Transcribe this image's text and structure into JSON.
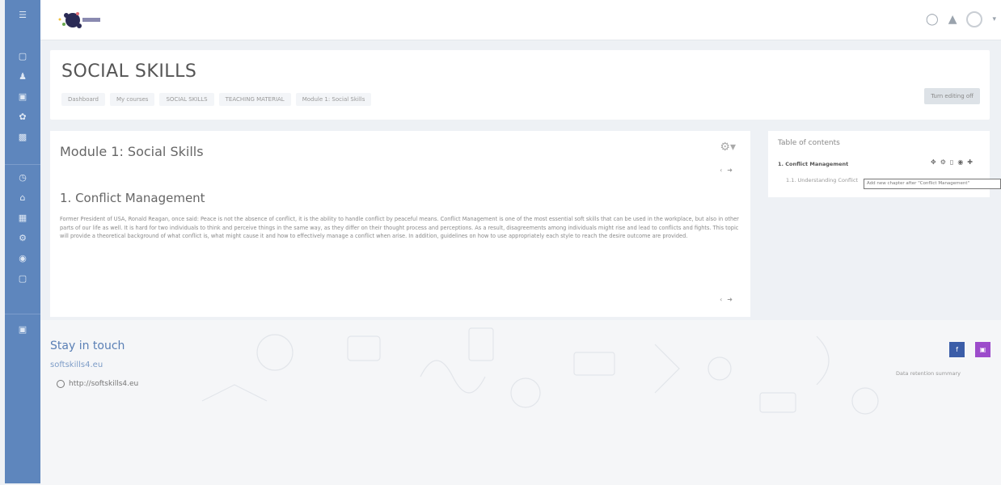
{
  "header": {
    "title": "SOCIAL SKILLS",
    "breadcrumbs": [
      "Dashboard",
      "My courses",
      "SOCIAL SKILLS",
      "TEACHING MATERIAL",
      "Module 1: Social Skills"
    ],
    "edit_label": "Turn editing off"
  },
  "topbar": {
    "icons": [
      "chat-icon",
      "bell-icon",
      "avatar",
      "chevron-down-icon"
    ]
  },
  "main": {
    "title": "Module 1: Social Skills",
    "chapter_title": "1. Conflict Management",
    "body": "Former President of USA, Ronald Reagan, once said: Peace is not the absence of conflict, it is the ability to handle conflict by peaceful means. Conflict Management is one of the most essential soft skills that can be used in the workplace, but also in other parts of our life as well. It is hard for two individuals to think and perceive things in the same way, as they differ on their thought process and perceptions. As a result, disagreements among individuals might rise and lead to conflicts and fights. This topic will provide a theoretical background of what conflict is, what might cause it and how to effectively manage a conflict when arise. In addition, guidelines on how to use appropriately each style to reach the desire outcome are provided."
  },
  "toc": {
    "title": "Table of contents",
    "chapter": "1. Conflict Management",
    "subchapter": "1.1. Understanding Conflict",
    "tooltip": "Add new chapter after \"Conflict Management\""
  },
  "footer": {
    "heading": "Stay in touch",
    "site": "softskills4.eu",
    "link": "http://softskills4.eu",
    "retention": "Data retention summary",
    "social": [
      "f",
      "ig"
    ]
  },
  "colors": {
    "rail": "#5e86bd",
    "facebook": "#3b5da8",
    "instagram": "#9c4ccb",
    "accent": "#5a7fb5"
  }
}
